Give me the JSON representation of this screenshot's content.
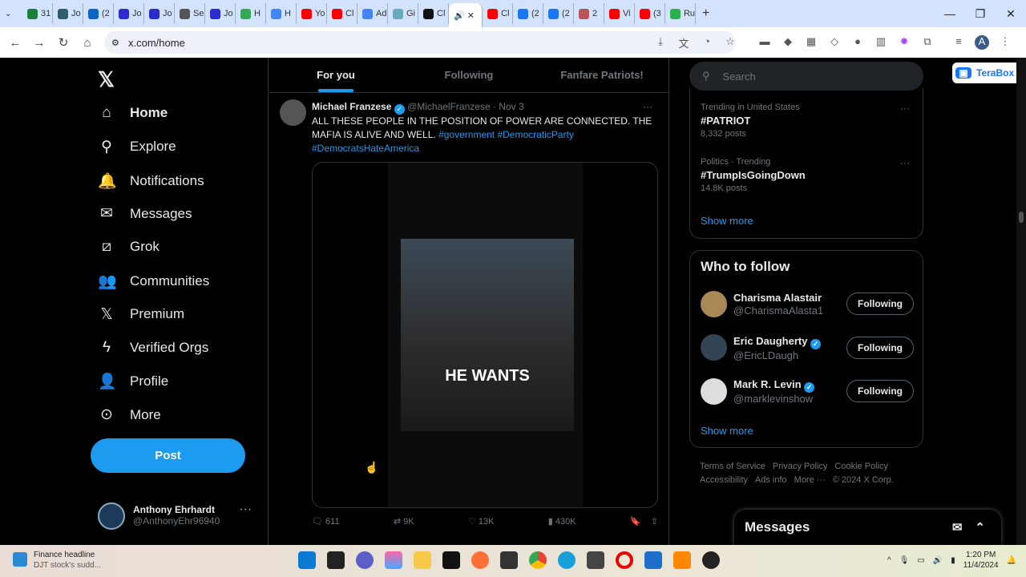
{
  "browser": {
    "tabs": [
      {
        "label": "31",
        "color": "#188038"
      },
      {
        "label": "Jo",
        "color": "#2e5e6e"
      },
      {
        "label": "(2",
        "color": "#0a66c2"
      },
      {
        "label": "Jo",
        "color": "#2b2bd0"
      },
      {
        "label": "Jo",
        "color": "#2b2bd0"
      },
      {
        "label": "Se",
        "color": "#555"
      },
      {
        "label": "Jo",
        "color": "#2b2bd0"
      },
      {
        "label": "H",
        "color": "#34a853"
      },
      {
        "label": "H",
        "color": "#4285f4"
      },
      {
        "label": "Yo",
        "color": "#ff0000"
      },
      {
        "label": "Cl",
        "color": "#ff0000"
      },
      {
        "label": "Ad",
        "color": "#4285f4"
      },
      {
        "label": "Gi",
        "color": "#6ab"
      },
      {
        "label": "Cl",
        "color": "#111"
      },
      {
        "label": "🔊 ✕",
        "color": "#000",
        "active": true
      },
      {
        "label": "Cl",
        "color": "#ff0000"
      },
      {
        "label": "(2",
        "color": "#1877f2"
      },
      {
        "label": "(2",
        "color": "#1877f2"
      },
      {
        "label": "2",
        "color": "#b55"
      },
      {
        "label": "Vi",
        "color": "#ff0000"
      },
      {
        "label": "(3",
        "color": "#ff0000"
      },
      {
        "label": "Ru",
        "color": "#2bb24c"
      }
    ],
    "new_tab": "+",
    "url": "x.com/home"
  },
  "sidebar": {
    "items": [
      {
        "label": "Home",
        "icon": "⌂"
      },
      {
        "label": "Explore",
        "icon": "⚲"
      },
      {
        "label": "Notifications",
        "icon": "🔔"
      },
      {
        "label": "Messages",
        "icon": "✉"
      },
      {
        "label": "Grok",
        "icon": "⧄"
      },
      {
        "label": "Communities",
        "icon": "👥"
      },
      {
        "label": "Premium",
        "icon": "𝕏"
      },
      {
        "label": "Verified Orgs",
        "icon": "ϟ"
      },
      {
        "label": "Profile",
        "icon": "👤"
      },
      {
        "label": "More",
        "icon": "⊙"
      }
    ],
    "post_label": "Post",
    "account": {
      "name": "Anthony Ehrhardt",
      "handle": "@AnthonyEhr96940"
    }
  },
  "feed": {
    "tabs": [
      "For you",
      "Following",
      "Fanfare Patriots!"
    ],
    "tweet": {
      "author": "Michael Franzese",
      "handle": "@MichaelFranzese",
      "date": "· Nov 3",
      "text": "ALL THESE PEOPLE IN THE POSITION OF POWER ARE CONNECTED. THE MAFIA IS ALIVE AND WELL.",
      "hashtags": [
        "#government",
        "#DemocraticParty",
        "#DemocratsHateAmerica"
      ],
      "video_caption": "HE WANTS",
      "replies": "611",
      "reposts": "9K",
      "likes": "13K",
      "views": "430K"
    }
  },
  "right": {
    "search_placeholder": "Search",
    "trends": [
      {
        "context": "Trending in United States",
        "tag": "#PATRIOT",
        "posts": "8,332 posts"
      },
      {
        "context": "Politics · Trending",
        "tag": "#TrumpIsGoingDown",
        "posts": "14.8K posts"
      }
    ],
    "show_more": "Show more",
    "who_to_follow": {
      "title": "Who to follow",
      "people": [
        {
          "name": "Charisma Alastair",
          "handle": "@CharismaAlasta1",
          "verified": false,
          "button": "Following"
        },
        {
          "name": "Eric Daugherty",
          "handle": "@EricLDaugh",
          "verified": true,
          "button": "Following"
        },
        {
          "name": "Mark R. Levin",
          "handle": "@marklevinshow",
          "verified": true,
          "button": "Following"
        }
      ],
      "show_more": "Show more"
    },
    "footer": [
      "Terms of Service",
      "Privacy Policy",
      "Cookie Policy",
      "Accessibility",
      "Ads info",
      "More ···",
      "© 2024 X Corp."
    ]
  },
  "messages_drawer": {
    "title": "Messages"
  },
  "terabox": {
    "label": "TeraBox"
  },
  "taskbar": {
    "news_title": "Finance headline",
    "news_sub": "DJT stock's sudd...",
    "time": "1:20 PM",
    "date": "11/4/2024"
  }
}
